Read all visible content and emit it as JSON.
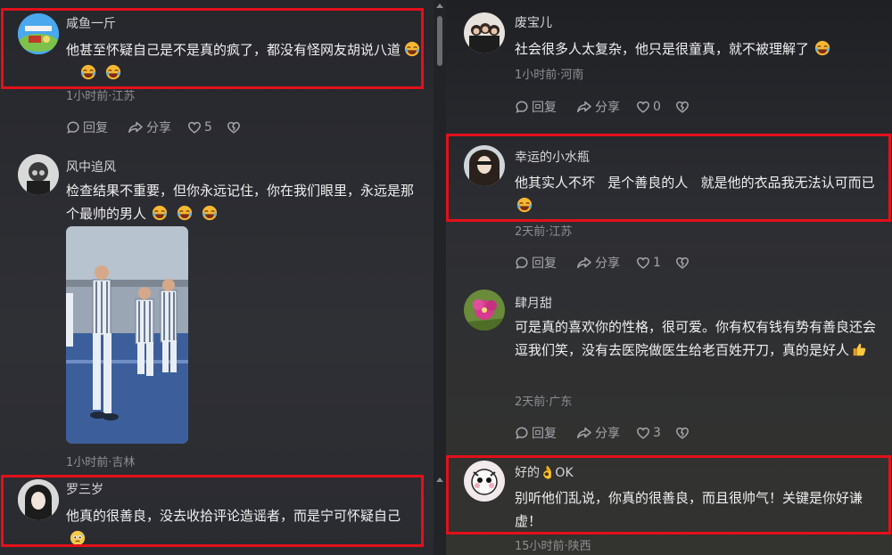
{
  "comments_left": [
    {
      "user": "咸鱼一斤",
      "text": "他甚至怀疑自己是不是真的疯了，都没有怪网友胡说八道",
      "meta": "1小时前·江苏",
      "reply": "回复",
      "share": "分享",
      "likes": "5"
    },
    {
      "user": "风中追风",
      "text": "检查结果不重要，但你永远记住，你在我们眼里，永远是那个最帅的男人",
      "meta": "1小时前·吉林"
    },
    {
      "user": "罗三岁",
      "text": "他真的很善良，没去收拾评论造谣者，而是宁可怀疑自己"
    }
  ],
  "comments_right": [
    {
      "user": "废宝儿",
      "text": "社会很多人太复杂，他只是很童真，就不被理解了",
      "meta": "1小时前·河南",
      "reply": "回复",
      "share": "分享",
      "likes": "0"
    },
    {
      "user": "幸运的小水瓶",
      "text": "他其实人不坏   是个善良的人   就是他的衣品我无法认可而已",
      "meta": "2天前·江苏",
      "reply": "回复",
      "share": "分享",
      "likes": "1"
    },
    {
      "user": "肆月甜",
      "text": "可是真的喜欢你的性格，很可爱。你有权有钱有势有善良还会逗我们笑，没有去医院做医生给老百姓开刀，真的是好人",
      "meta": "2天前·广东",
      "reply": "回复",
      "share": "分享",
      "likes": "3"
    },
    {
      "user": "好的👌OK",
      "text": "别听他们乱说，你真的很善良，而且很帅气！关键是你好谦虚！",
      "meta": "15小时前·陕西"
    }
  ],
  "colors": {
    "highlight": "#e3101a",
    "background": "#2b2c31",
    "text": "#f0f0f2",
    "meta": "#8e8f94"
  },
  "icons": [
    "comment-reply-icon",
    "share-arrow-icon",
    "heart-icon",
    "broken-heart-icon",
    "laugh-cry-emoji",
    "thumbs-up-emoji",
    "anxious-face-emoji"
  ]
}
